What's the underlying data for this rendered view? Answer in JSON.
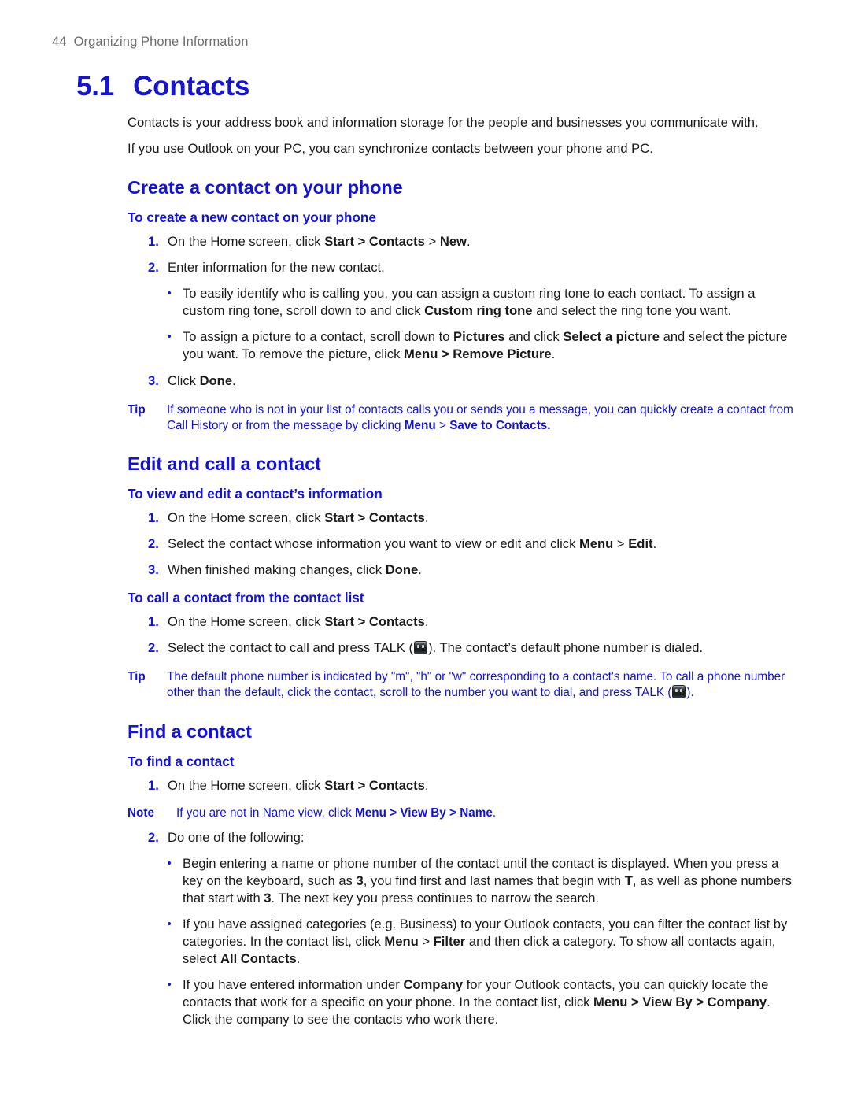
{
  "header": {
    "page_number": "44",
    "running_title": "Organizing Phone Information"
  },
  "chapter": {
    "number": "5.1",
    "title": "Contacts"
  },
  "colors": {
    "heading_blue": "#1414CD",
    "title_blue": "#1616CE",
    "body_black": "#1A1A1A",
    "header_gray": "#6E6E6E"
  },
  "intro": {
    "p1": "Contacts is your address book and information storage for the people and businesses you communicate with.",
    "p2": "If you use Outlook on your PC, you can synchronize contacts between your phone and PC."
  },
  "sections": [
    {
      "h2": "Create a contact on your phone",
      "h3": "To create a new contact on your phone",
      "step1_pre": "On the Home screen, click ",
      "step1_b1": "Start > Contacts",
      "step1_mid": " > ",
      "step1_b2": "New",
      "step1_end": ".",
      "step2": "Enter information for the new contact.",
      "bullet1_a": "To easily identify who is calling you, you can assign a custom ring tone to each contact. To assign a custom ring tone, scroll down to and click ",
      "bullet1_b": "Custom ring tone",
      "bullet1_c": " and select the ring tone you want.",
      "bullet2_a": "To assign a picture to a contact, scroll down to ",
      "bullet2_b": "Pictures",
      "bullet2_c": " and click ",
      "bullet2_d": "Select a picture",
      "bullet2_e": " and select the picture you want. To remove the picture, click ",
      "bullet2_f": "Menu > Remove Picture",
      "bullet2_g": ".",
      "step3_pre": "Click ",
      "step3_b": "Done",
      "step3_end": ".",
      "tip_label": "Tip",
      "tip_a": "If someone who is not in your list of contacts calls you or sends you a message, you can quickly create a contact from Call History or from the message by clicking ",
      "tip_b": "Menu",
      "tip_c": " > ",
      "tip_d": "Save to Contacts."
    },
    {
      "h2": "Edit and call a contact",
      "h3a": "To view and edit a contact’s information",
      "a_step1_pre": "On the Home screen, click ",
      "a_step1_b": "Start > Contacts",
      "a_step1_end": ".",
      "a_step2_pre": "Select the contact whose information you want to view or edit and click ",
      "a_step2_b1": "Menu",
      "a_step2_mid": " > ",
      "a_step2_b2": "Edit",
      "a_step2_end": ".",
      "a_step3_pre": "When finished making changes, click ",
      "a_step3_b": "Done",
      "a_step3_end": ".",
      "h3b": "To call a contact from the contact list",
      "b_step1_pre": "On the Home screen, click ",
      "b_step1_b": "Start > Contacts",
      "b_step1_end": ".",
      "b_step2_pre": "Select the contact to call and press TALK (",
      "b_step2_post": "). The contact’s default phone number is dialed.",
      "tip_label": "Tip",
      "tip_a": "The default phone number is indicated by \"m\", \"h\" or \"w\" corresponding to a contact's name. To call a phone number other than the default, click the contact, scroll to the number you want to dial, and press TALK (",
      "tip_b": ")."
    },
    {
      "h2": "Find a contact",
      "h3": "To find a contact",
      "step1_pre": "On the Home screen, click ",
      "step1_b": "Start > Contacts",
      "step1_end": ".",
      "note_label": "Note",
      "note_a": "If you are not in Name view, click ",
      "note_b": "Menu > View By > Name",
      "note_c": ".",
      "step2": "Do one of the following:",
      "bullet1_a": "Begin entering a name or phone number of the contact until the contact is displayed. When you press a key on the keyboard, such as ",
      "bullet1_b": "3",
      "bullet1_c": ", you find first and last names that begin with ",
      "bullet1_d": "T",
      "bullet1_e": ", as well as phone numbers that start with ",
      "bullet1_f": "3",
      "bullet1_g": ". The next key you press continues to narrow the search.",
      "bullet2_a": "If you have assigned categories (e.g. Business) to your Outlook contacts, you can filter the contact list by categories. In the contact list, click ",
      "bullet2_b": "Menu",
      "bullet2_c": " > ",
      "bullet2_d": "Filter",
      "bullet2_e": " and then click a category. To show all contacts again, select ",
      "bullet2_f": "All Contacts",
      "bullet2_g": ".",
      "bullet3_a": "If you have entered information under ",
      "bullet3_b": "Company",
      "bullet3_c": " for your Outlook contacts, you can quickly locate the contacts that work for a specific on your phone. In the contact list, click ",
      "bullet3_d": "Menu > View By > Company",
      "bullet3_e": ". Click the company to see the contacts who work there."
    }
  ],
  "icons": {
    "talk_key": "talk-key-icon"
  }
}
